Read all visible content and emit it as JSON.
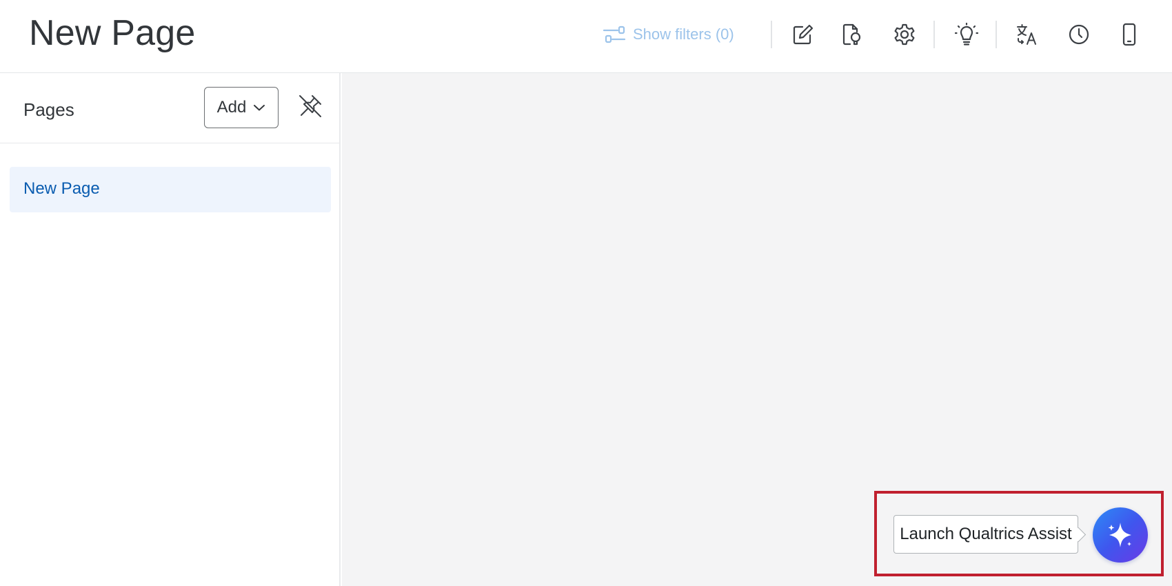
{
  "header": {
    "title": "New Page",
    "filters_label": "Show filters (0)",
    "tools": [
      {
        "icon": "edit-icon"
      },
      {
        "icon": "lightbulb-document-icon"
      },
      {
        "icon": "settings-gear-icon"
      },
      {
        "icon": "idea-lightbulb-icon"
      },
      {
        "icon": "translate-icon"
      },
      {
        "icon": "history-clock-icon"
      },
      {
        "icon": "mobile-preview-icon"
      }
    ]
  },
  "sidebar": {
    "heading": "Pages",
    "add_label": "Add",
    "items": [
      {
        "label": "New Page",
        "selected": true
      }
    ]
  },
  "assist": {
    "tooltip": "Launch Qualtrics Assist",
    "icon": "sparkle-icon"
  },
  "colors": {
    "accent": "#0a5cb0",
    "filters_text": "#9cc3ea",
    "selected_bg": "#eef4fd",
    "highlight": "#c0202f",
    "assist_gradient_start": "#2d8cf6",
    "assist_gradient_end": "#6a3ae6"
  }
}
